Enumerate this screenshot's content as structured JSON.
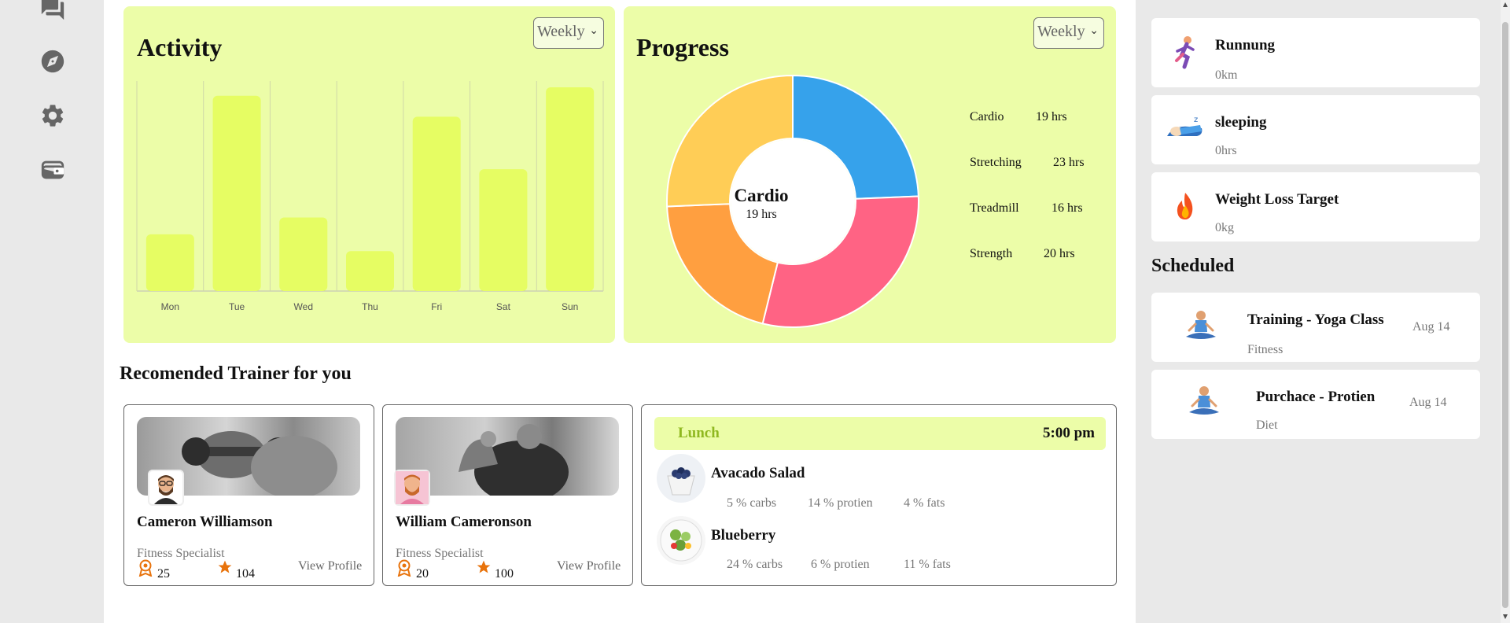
{
  "rail": {
    "icons": [
      "chat-icon",
      "compass-icon",
      "gear-icon",
      "wallet-icon"
    ]
  },
  "activity": {
    "title": "Activity",
    "period": "Weekly"
  },
  "progress": {
    "title": "Progress",
    "period": "Weekly",
    "center_label": "Cardio",
    "center_value": "19 hrs",
    "legend": [
      {
        "label": "Cardio",
        "value": "19 hrs"
      },
      {
        "label": "Stretching",
        "value": "23 hrs"
      },
      {
        "label": "Treadmill",
        "value": "16 hrs"
      },
      {
        "label": "Strength",
        "value": "20 hrs"
      }
    ]
  },
  "chart_data": [
    {
      "type": "bar",
      "categories": [
        "Mon",
        "Tue",
        "Wed",
        "Thu",
        "Fri",
        "Sat",
        "Sun"
      ],
      "values": [
        27,
        93,
        35,
        19,
        83,
        58,
        97
      ],
      "ylim": [
        0,
        100
      ],
      "grid": true,
      "color": "#e6fd63"
    },
    {
      "type": "pie",
      "donut": true,
      "categories": [
        "Cardio",
        "Stretching",
        "Treadmill",
        "Strength"
      ],
      "values": [
        19,
        23,
        16,
        20
      ],
      "colors": [
        "#36a2eb",
        "#ff6384",
        "#ff9f40",
        "#ffcd56"
      ]
    }
  ],
  "trainers_heading": "Recomended Trainer for you",
  "trainers": [
    {
      "name": "Cameron Williamson",
      "role": "Fitness Specialist",
      "badges": "25",
      "rating": "104",
      "link": "View Profile"
    },
    {
      "name": "William Cameronson",
      "role": "Fitness Specialist",
      "badges": "20",
      "rating": "100",
      "link": "View Profile"
    }
  ],
  "meal": {
    "label": "Lunch",
    "time": "5:00 pm",
    "items": [
      {
        "name": "Avacado Salad",
        "carbs": "5 % carbs",
        "protein": "14 % protien",
        "fats": "4 % fats"
      },
      {
        "name": "Blueberry",
        "carbs": "24 % carbs",
        "protein": "6 % protien",
        "fats": "11 % fats"
      }
    ]
  },
  "goals": [
    {
      "title": "Runnung",
      "value": "0km",
      "icon": "runner-icon"
    },
    {
      "title": "sleeping",
      "value": "0hrs",
      "icon": "sleeping-icon"
    },
    {
      "title": "Weight Loss Target",
      "value": "0kg",
      "icon": "fire-icon"
    }
  ],
  "scheduled_heading": "Scheduled",
  "scheduled": [
    {
      "title": "Training - Yoga Class",
      "category": "Fitness",
      "date": "Aug 14",
      "icon": "yoga-icon"
    },
    {
      "title": "Purchace - Protien",
      "category": "Diet",
      "date": "Aug 14",
      "icon": "yoga-icon"
    }
  ]
}
